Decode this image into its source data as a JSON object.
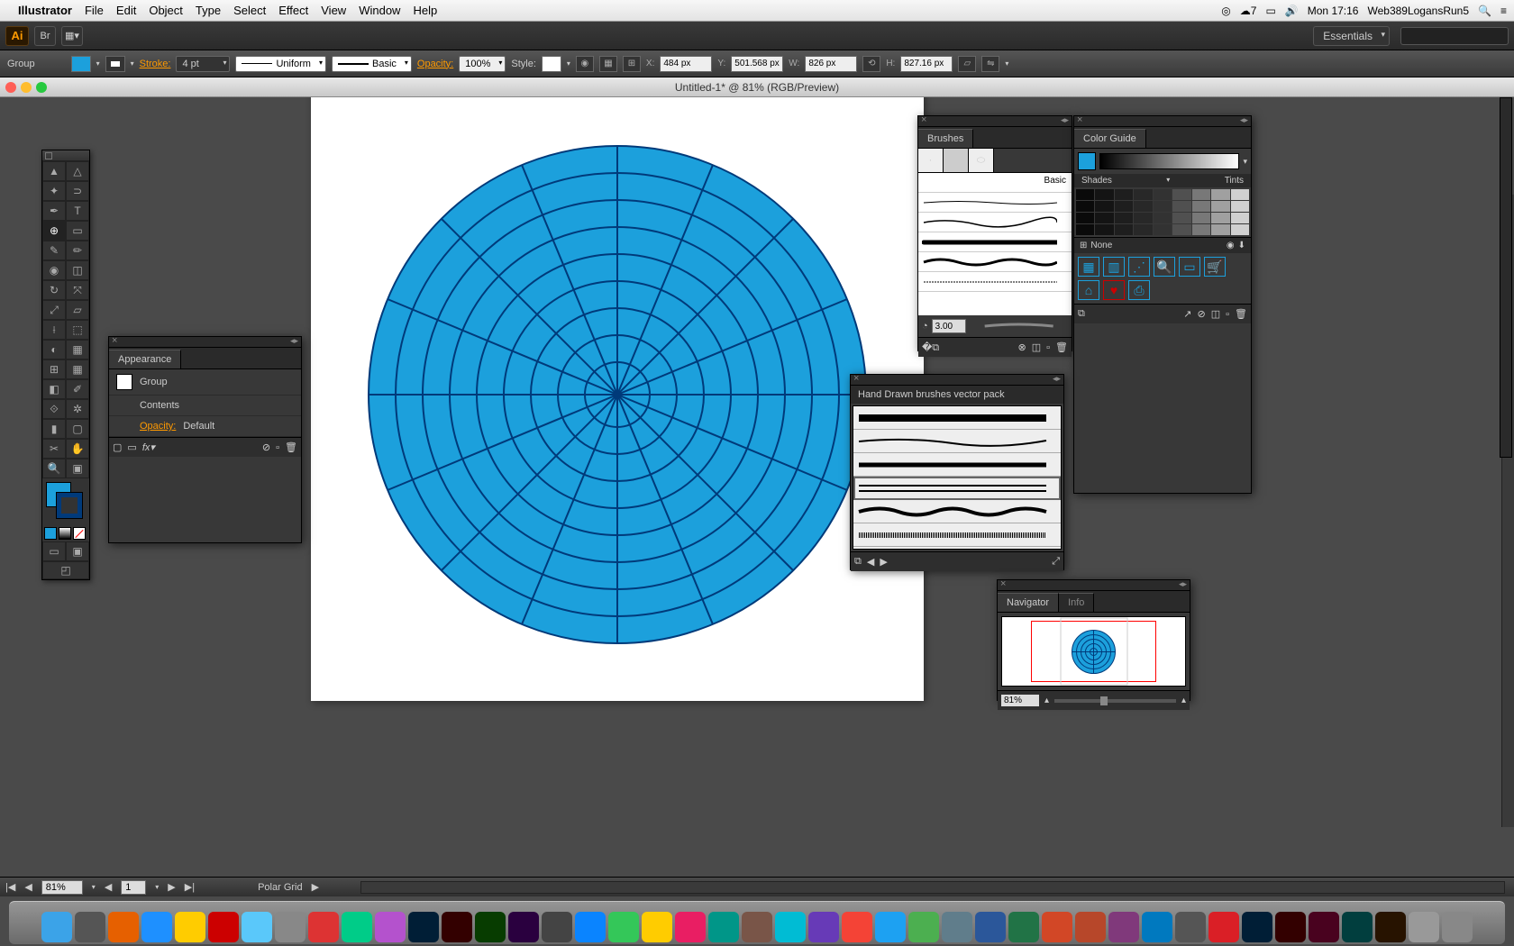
{
  "menubar": {
    "app": "Illustrator",
    "items": [
      "File",
      "Edit",
      "Object",
      "Type",
      "Select",
      "Effect",
      "View",
      "Window",
      "Help"
    ],
    "right": {
      "battery_pct": "7",
      "time": "Mon 17:16",
      "user": "Web389LogansRun5"
    }
  },
  "app_bar": {
    "workspace": "Essentials"
  },
  "control_bar": {
    "selection": "Group",
    "stroke_label": "Stroke:",
    "stroke_weight": "4 pt",
    "stroke_profile": "Uniform",
    "brush": "Basic",
    "opacity_label": "Opacity:",
    "opacity": "100%",
    "style_label": "Style:",
    "x_label": "X:",
    "x": "484 px",
    "y_label": "Y:",
    "y": "501.568 px",
    "w_label": "W:",
    "w": "826 px",
    "h_label": "H:",
    "h": "827.16 px"
  },
  "document": {
    "title": "Untitled-1* @ 81% (RGB/Preview)"
  },
  "appearance": {
    "title": "Appearance",
    "object": "Group",
    "contents": "Contents",
    "opacity_label": "Opacity:",
    "opacity_val": "Default"
  },
  "brushes": {
    "title": "Brushes",
    "basic_label": "Basic",
    "width": "3.00"
  },
  "colorguide": {
    "title": "Color Guide",
    "shades": "Shades",
    "tints": "Tints",
    "none": "None"
  },
  "handdrawn": {
    "title": "Hand Drawn brushes vector pack"
  },
  "navigator": {
    "tab1": "Navigator",
    "tab2": "Info",
    "zoom": "81%"
  },
  "status": {
    "zoom": "81%",
    "page": "1",
    "tool": "Polar Grid"
  },
  "dock": {
    "apps": [
      "Finder",
      "Dashboard",
      "Firefox",
      "Safari",
      "Chrome",
      "Opera",
      "Mail",
      "Search",
      "iCal",
      "FaceTime",
      "iTunes",
      "Photoshop",
      "Illustrator",
      "Dreamweaver",
      "AfterEffects",
      "Camera",
      "AppStore",
      "Maps",
      "Weather",
      "Photos",
      "Speed",
      "Brush",
      "Snow",
      "Paint",
      "Ball",
      "Twitter",
      "Torrent",
      "Folder",
      "MS",
      "World",
      "Excel",
      "PowerPoint",
      "OneNote",
      "Trello",
      "Scan",
      "Adobe",
      "Ps",
      "Ai",
      "Id",
      "Lr",
      "Br",
      "Box",
      "Trash"
    ]
  }
}
